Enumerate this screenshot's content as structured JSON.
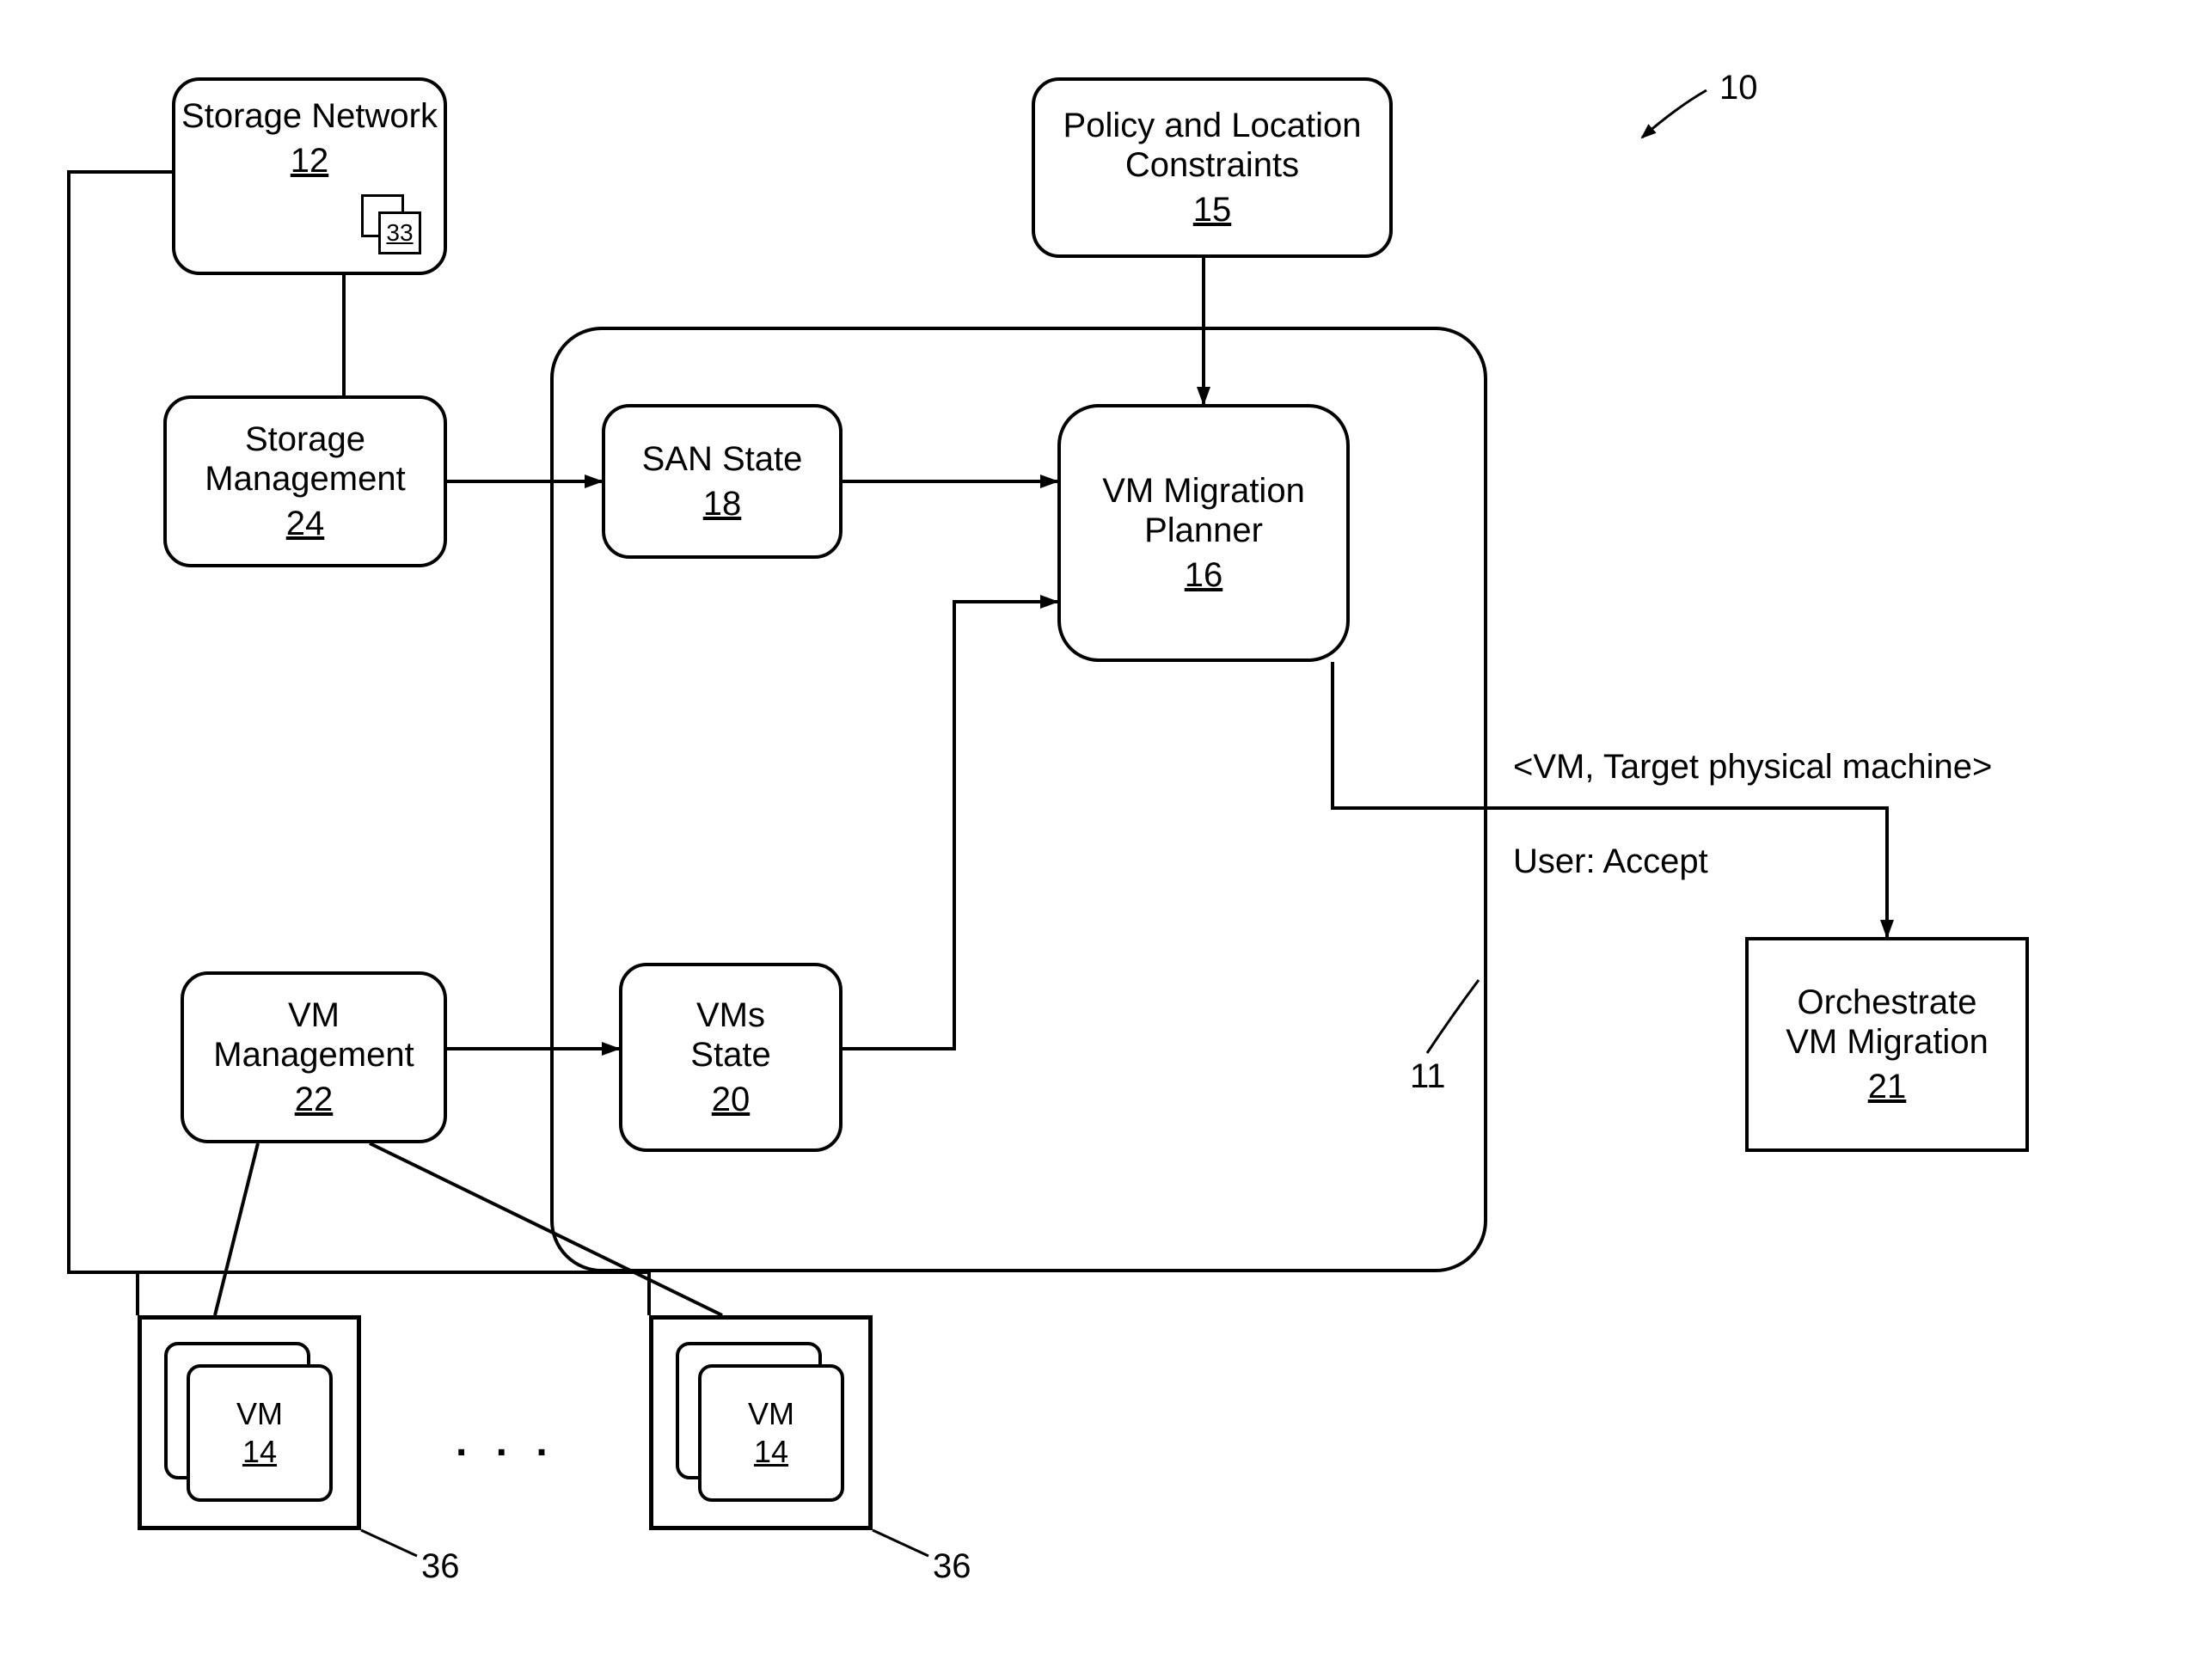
{
  "refs": {
    "system": "10",
    "container": "11",
    "storage_network": "12",
    "storage_network_inner": "33",
    "storage_management": "24",
    "vm_management": "22",
    "san_state": "18",
    "vms_state": "20",
    "policy": "15",
    "planner": "16",
    "orchestrate": "21",
    "vm_a": "14",
    "vm_b": "14",
    "host_a": "36",
    "host_b": "36"
  },
  "labels": {
    "storage_network": "Storage Network",
    "storage_management_l1": "Storage",
    "storage_management_l2": "Management",
    "vm_management_l1": "VM",
    "vm_management_l2": "Management",
    "san_state": "SAN State",
    "vms_state_l1": "VMs",
    "vms_state_l2": "State",
    "policy_l1": "Policy and Location",
    "policy_l2": "Constraints",
    "planner_l1": "VM Migration",
    "planner_l2": "Planner",
    "orchestrate_l1": "Orchestrate",
    "orchestrate_l2": "VM Migration",
    "output_tuple": "<VM, Target physical machine>",
    "user_accept": "User: Accept",
    "vm": "VM",
    "ellipsis": ". . ."
  }
}
